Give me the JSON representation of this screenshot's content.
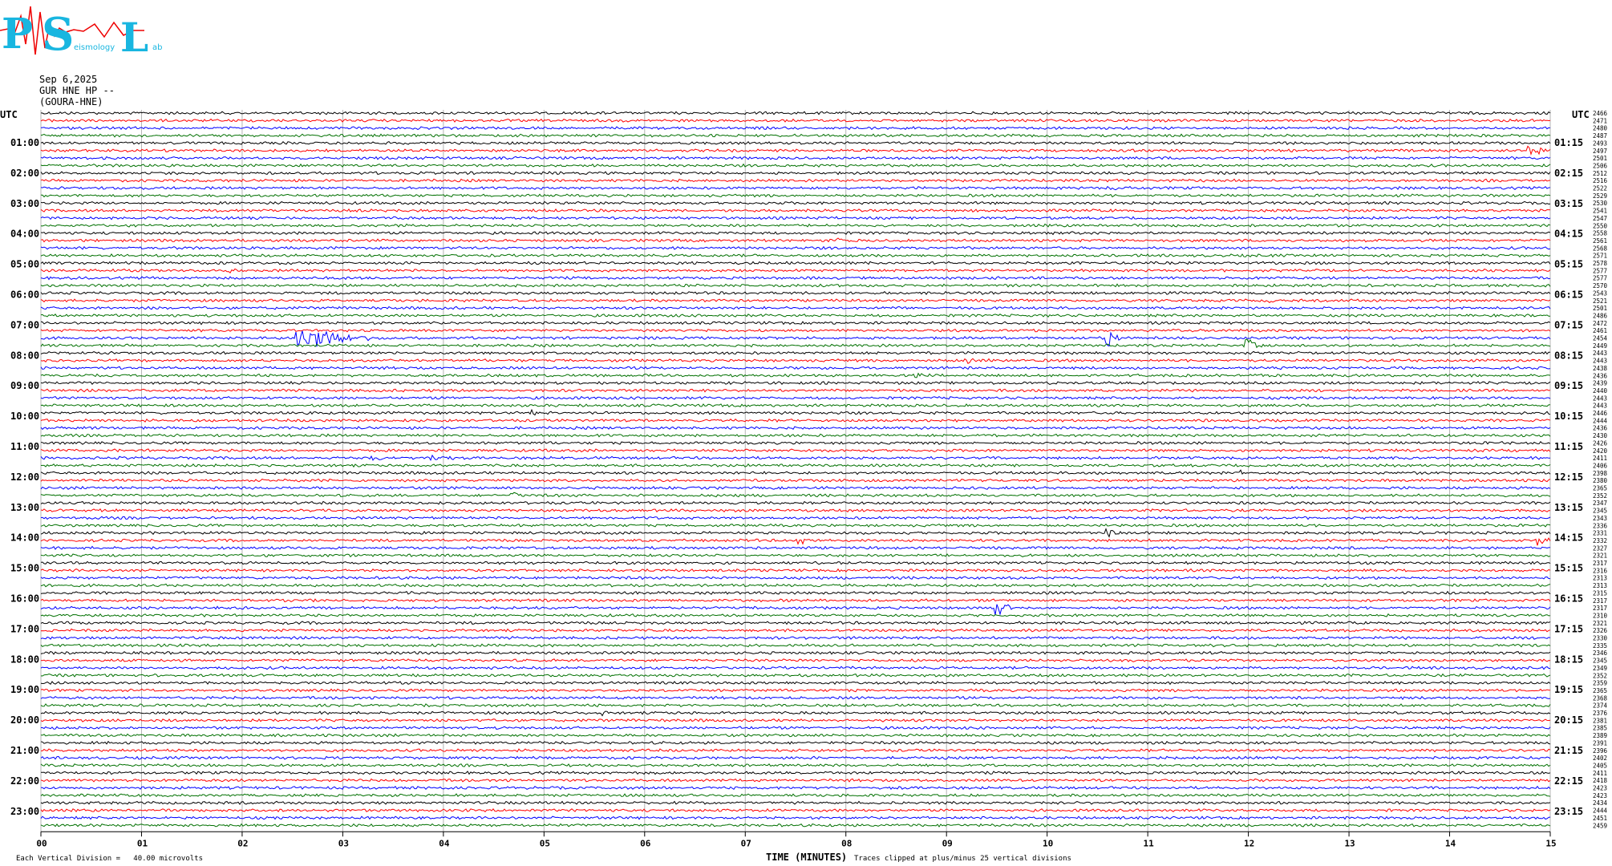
{
  "logo": {
    "letters": [
      "P",
      "S",
      "L"
    ],
    "small_texts": [
      "eismology",
      "ab"
    ]
  },
  "header": {
    "date": "Sep 6,2025",
    "channel": "GUR HNE HP --",
    "station": "(GOURA-HNE)"
  },
  "utc_left": "UTC",
  "utc_right": "UTC",
  "footer": {
    "left": "Each Vertical Division =   40.00 microvolts",
    "x_title": "TIME (MINUTES)",
    "right": "Traces clipped at plus/minus 25 vertical divisions"
  },
  "chart_data": {
    "type": "line",
    "title": "",
    "xlabel": "TIME (MINUTES)",
    "xlim": [
      0,
      15
    ],
    "x_ticks": [
      "00",
      "01",
      "02",
      "03",
      "04",
      "05",
      "06",
      "07",
      "08",
      "09",
      "10",
      "11",
      "12",
      "13",
      "14",
      "15"
    ],
    "trace_count": 96,
    "trace_minutes": 15,
    "trace_colors": [
      "#000000",
      "#ff0000",
      "#0000ff",
      "#007000"
    ],
    "left_hour_labels": [
      "01:00",
      "02:00",
      "03:00",
      "04:00",
      "05:00",
      "06:00",
      "07:00",
      "08:00",
      "09:00",
      "10:00",
      "11:00",
      "12:00",
      "13:00",
      "14:00",
      "15:00",
      "16:00",
      "17:00",
      "18:00",
      "19:00",
      "20:00",
      "21:00",
      "22:00",
      "23:00"
    ],
    "right_hour_labels": [
      "01:15",
      "02:15",
      "03:15",
      "04:15",
      "05:15",
      "06:15",
      "07:15",
      "08:15",
      "09:15",
      "10:15",
      "11:15",
      "12:15",
      "13:15",
      "14:15",
      "15:15",
      "16:15",
      "17:15",
      "18:15",
      "19:15",
      "20:15",
      "21:15",
      "22:15",
      "23:15"
    ],
    "right_trace_values": [
      "2466",
      "2471",
      "2480",
      "2487",
      "2493",
      "2497",
      "2501",
      "2506",
      "2512",
      "2516",
      "2522",
      "2529",
      "2530",
      "2541",
      "2547",
      "2550",
      "2558",
      "2561",
      "2568",
      "2571",
      "2578",
      "2577",
      "2577",
      "2570",
      "2543",
      "2521",
      "2501",
      "2486",
      "2472",
      "2461",
      "2454",
      "2449",
      "2443",
      "2443",
      "2438",
      "2436",
      "2439",
      "2440",
      "2443",
      "2443",
      "2446",
      "2444",
      "2436",
      "2430",
      "2426",
      "2420",
      "2411",
      "2406",
      "2398",
      "2380",
      "2365",
      "2352",
      "2347",
      "2345",
      "2343",
      "2336",
      "2331",
      "2332",
      "2327",
      "2321",
      "2317",
      "2316",
      "2313",
      "2313",
      "2315",
      "2317",
      "2317",
      "2310",
      "2321",
      "2326",
      "2330",
      "2335",
      "2346",
      "2345",
      "2349",
      "2352",
      "2359",
      "2365",
      "2368",
      "2374",
      "2376",
      "2381",
      "2385",
      "2389",
      "2391",
      "2396",
      "2402",
      "2405",
      "2411",
      "2418",
      "2423",
      "2423",
      "2434",
      "2444",
      "2451",
      "2459"
    ],
    "events": [
      {
        "trace": 5,
        "minute": 14.8,
        "amp": 9,
        "dur": 0.25
      },
      {
        "trace": 10,
        "minute": 10.6,
        "amp": 3,
        "dur": 0.5
      },
      {
        "trace": 17,
        "minute": 7.95,
        "amp": 5,
        "dur": 0.12
      },
      {
        "trace": 21,
        "minute": 1.9,
        "amp": 3,
        "dur": 0.1
      },
      {
        "trace": 25,
        "minute": 12.2,
        "amp": 3,
        "dur": 0.15
      },
      {
        "trace": 30,
        "minute": 2.55,
        "amp": 18,
        "dur": 1.0
      },
      {
        "trace": 30,
        "minute": 10.6,
        "amp": 12,
        "dur": 0.2
      },
      {
        "trace": 31,
        "minute": 12.0,
        "amp": 9,
        "dur": 0.2
      },
      {
        "trace": 33,
        "minute": 9.2,
        "amp": 5,
        "dur": 0.25
      },
      {
        "trace": 35,
        "minute": 8.7,
        "amp": 3,
        "dur": 0.3
      },
      {
        "trace": 40,
        "minute": 4.9,
        "amp": 3,
        "dur": 0.2
      },
      {
        "trace": 46,
        "minute": 3.3,
        "amp": 4,
        "dur": 0.3
      },
      {
        "trace": 46,
        "minute": 3.9,
        "amp": 4,
        "dur": 0.3
      },
      {
        "trace": 48,
        "minute": 11.95,
        "amp": 5,
        "dur": 0.2
      },
      {
        "trace": 51,
        "minute": 4.7,
        "amp": 6,
        "dur": 0.2
      },
      {
        "trace": 56,
        "minute": 10.6,
        "amp": 6,
        "dur": 0.3
      },
      {
        "trace": 57,
        "minute": 7.55,
        "amp": 8,
        "dur": 0.15
      },
      {
        "trace": 57,
        "minute": 14.9,
        "amp": 10,
        "dur": 0.15
      },
      {
        "trace": 66,
        "minute": 9.5,
        "amp": 10,
        "dur": 0.3
      },
      {
        "trace": 80,
        "minute": 5.6,
        "amp": 3,
        "dur": 0.1
      }
    ]
  }
}
